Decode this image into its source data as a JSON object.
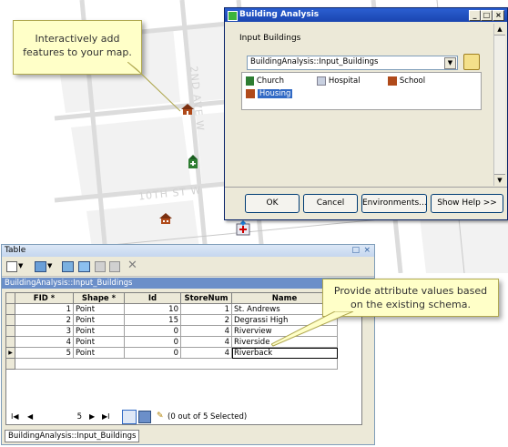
{
  "map": {
    "street_labels": [
      "2ND AVE W",
      "10TH ST W"
    ],
    "icon_names": [
      "housing-icon",
      "church-icon",
      "school-icon",
      "hospital-icon"
    ]
  },
  "callouts": {
    "add_features": "Interactively add features to your map.",
    "attribute_values": "Provide attribute values based on the existing schema."
  },
  "dialog": {
    "title": "Building Analysis",
    "section_label": "Input Buildings",
    "dropdown_value": "BuildingAnalysis::Input_Buildings",
    "templates": [
      {
        "label": "Church",
        "icon": "church-icon"
      },
      {
        "label": "Hospital",
        "icon": "hospital-icon"
      },
      {
        "label": "School",
        "icon": "school-icon"
      },
      {
        "label": "Housing",
        "icon": "housing-icon",
        "selected": true
      }
    ],
    "buttons": {
      "ok": "OK",
      "cancel": "Cancel",
      "environments": "Environments...",
      "show_help": "Show Help >>"
    },
    "window_controls": {
      "minimize": "_",
      "maximize": "□",
      "close": "×"
    }
  },
  "table": {
    "window_title": "Table",
    "layer_name": "BuildingAnalysis::Input_Buildings",
    "columns": [
      "FID *",
      "Shape *",
      "Id",
      "StoreNum",
      "Name"
    ],
    "rows": [
      [
        "1",
        "Point",
        "10",
        "1",
        "St. Andrews"
      ],
      [
        "2",
        "Point",
        "15",
        "2",
        "Degrassi High"
      ],
      [
        "3",
        "Point",
        "0",
        "4",
        "Riverview"
      ],
      [
        "4",
        "Point",
        "0",
        "4",
        "Riverside"
      ],
      [
        "5",
        "Point",
        "0",
        "4",
        "Riverback"
      ]
    ],
    "current_record": "5",
    "selection_status": "(0 out of 5 Selected)",
    "bottom_tab": "BuildingAnalysis::Input_Buildings",
    "window_controls": {
      "restore": "□",
      "close": "×"
    }
  }
}
